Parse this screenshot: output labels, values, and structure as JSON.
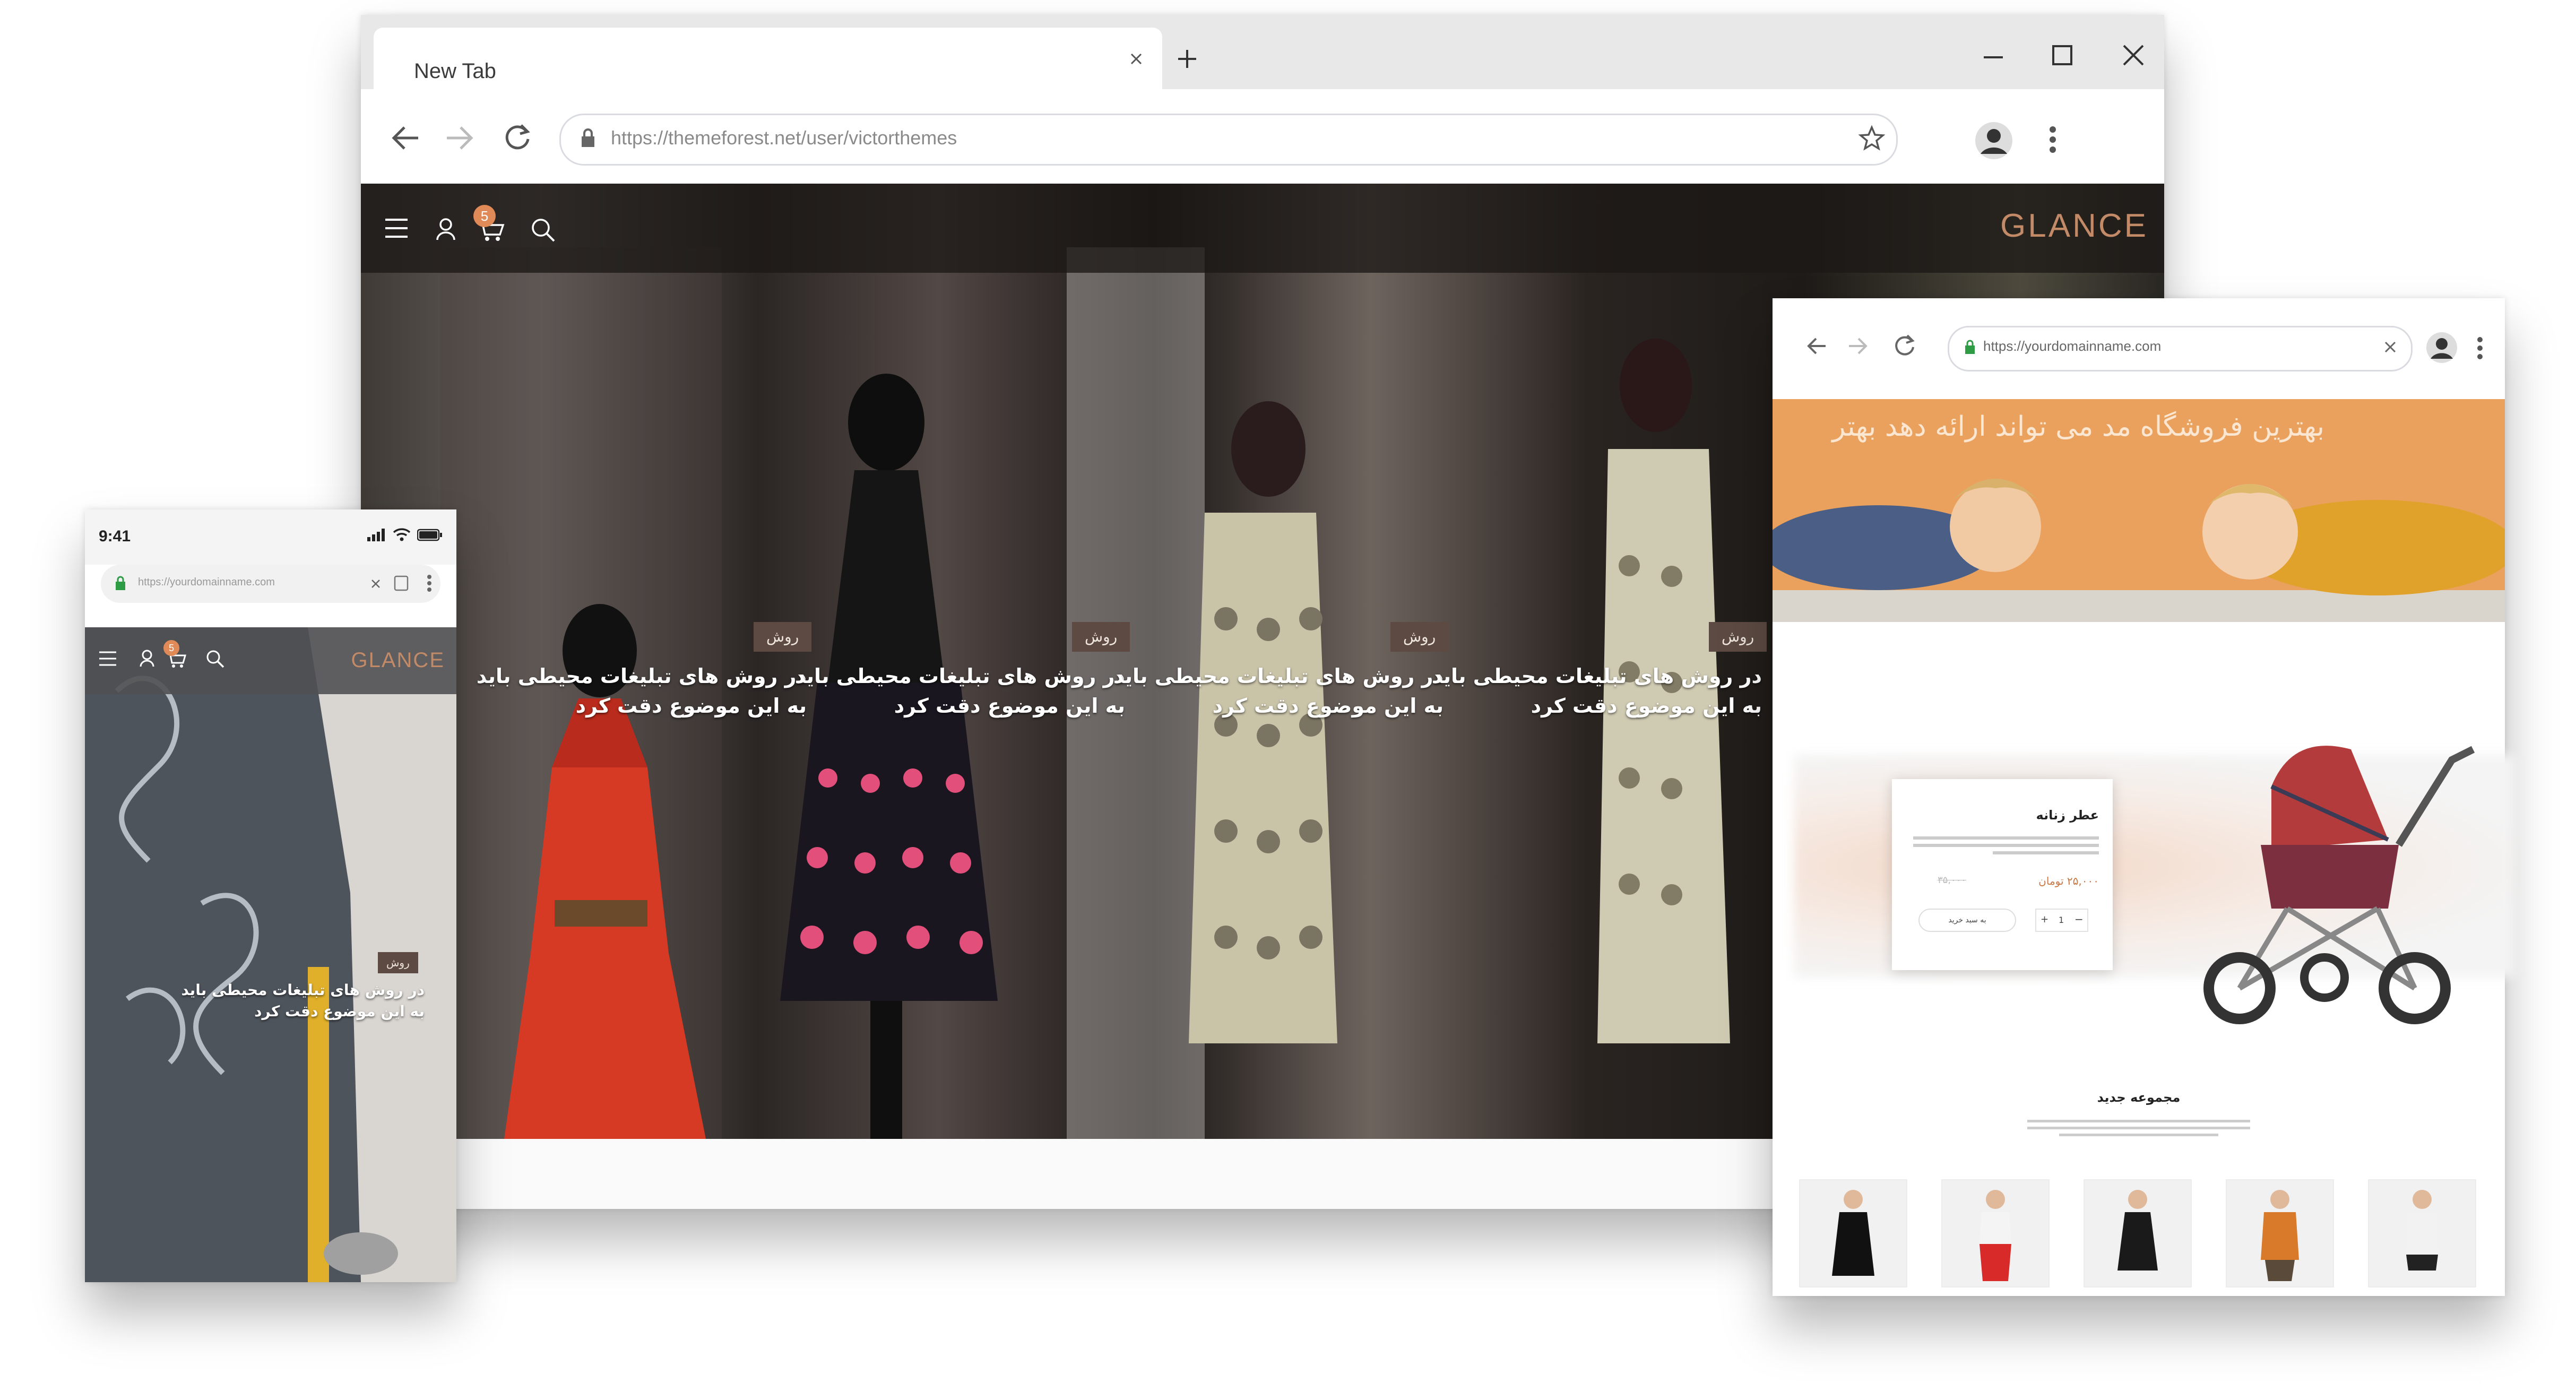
{
  "main_browser": {
    "tab_title": "New Tab",
    "url": "https://themeforest.net/user/victorthemes",
    "site": {
      "logo": "GLANCE",
      "cart_count": "5",
      "panels": [
        {
          "tag": "روش",
          "caption_line1": "در روش های تبلیغات محیطی باید",
          "caption_line2": "به این موضوع دقت کرد"
        },
        {
          "tag": "روش",
          "caption_line1": "در روش های تبلیغات محیطی باید",
          "caption_line2": "به این موضوع دقت کرد"
        },
        {
          "tag": "روش",
          "caption_line1": "در روش های تبلیغات محیطی باید",
          "caption_line2": "به این موضوع دقت کرد"
        },
        {
          "tag": "روش",
          "caption_line1": "در روش های تبلیغات محیطی باید",
          "caption_line2": "به این موضوع دقت کرد"
        }
      ]
    }
  },
  "phone": {
    "time": "9:41",
    "url": "https://yourdomainname.com",
    "site": {
      "logo": "GLANCE",
      "cart_count": "5",
      "tag": "روش",
      "caption_line1": "در روش های تبلیغات محیطی باید",
      "caption_line2": "به این موضوع دقت کرد"
    }
  },
  "second_browser": {
    "url": "https://yourdomainname.com",
    "banner_text": "بهترین فروشگاه مد می تواند ارائه دهد  بهتر",
    "product": {
      "title": "عطر زنانه",
      "price": "۲۵,۰۰۰ تومان",
      "old_price": "۳۵,۰۰۰",
      "add_to_cart": "به سبد خرید",
      "qty": "1"
    },
    "section_title": "مجموعه جدید"
  },
  "colors": {
    "accent": "#c38a68",
    "badge": "#e08a57",
    "tag_bg": "#5d4b43",
    "banner": "#e9a15d"
  }
}
